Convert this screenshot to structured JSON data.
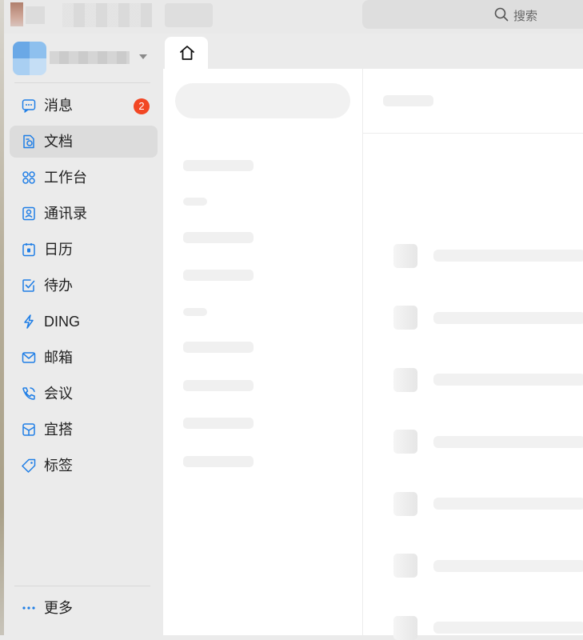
{
  "header": {
    "search": {
      "label": "搜索",
      "icon": "search-icon"
    }
  },
  "sidebar": {
    "items": [
      {
        "label": "消息",
        "icon": "message-icon",
        "badge": "2",
        "active": false
      },
      {
        "label": "文档",
        "icon": "document-icon",
        "active": true
      },
      {
        "label": "工作台",
        "icon": "workbench-grid-icon",
        "active": false
      },
      {
        "label": "通讯录",
        "icon": "contacts-icon",
        "active": false
      },
      {
        "label": "日历",
        "icon": "calendar-icon",
        "active": false
      },
      {
        "label": "待办",
        "icon": "todo-check-icon",
        "active": false
      },
      {
        "label": "DING",
        "icon": "lightning-icon",
        "active": false
      },
      {
        "label": "邮箱",
        "icon": "mail-icon",
        "active": false
      },
      {
        "label": "会议",
        "icon": "meeting-phone-icon",
        "active": false
      },
      {
        "label": "宜搭",
        "icon": "yida-box-icon",
        "active": false
      },
      {
        "label": "标签",
        "icon": "tag-icon",
        "active": false
      }
    ],
    "more_label": "更多"
  },
  "tabs": [
    {
      "icon": "home-icon",
      "active": true
    }
  ],
  "colors": {
    "accent": "#1f7ee6",
    "badge": "#f24724"
  }
}
